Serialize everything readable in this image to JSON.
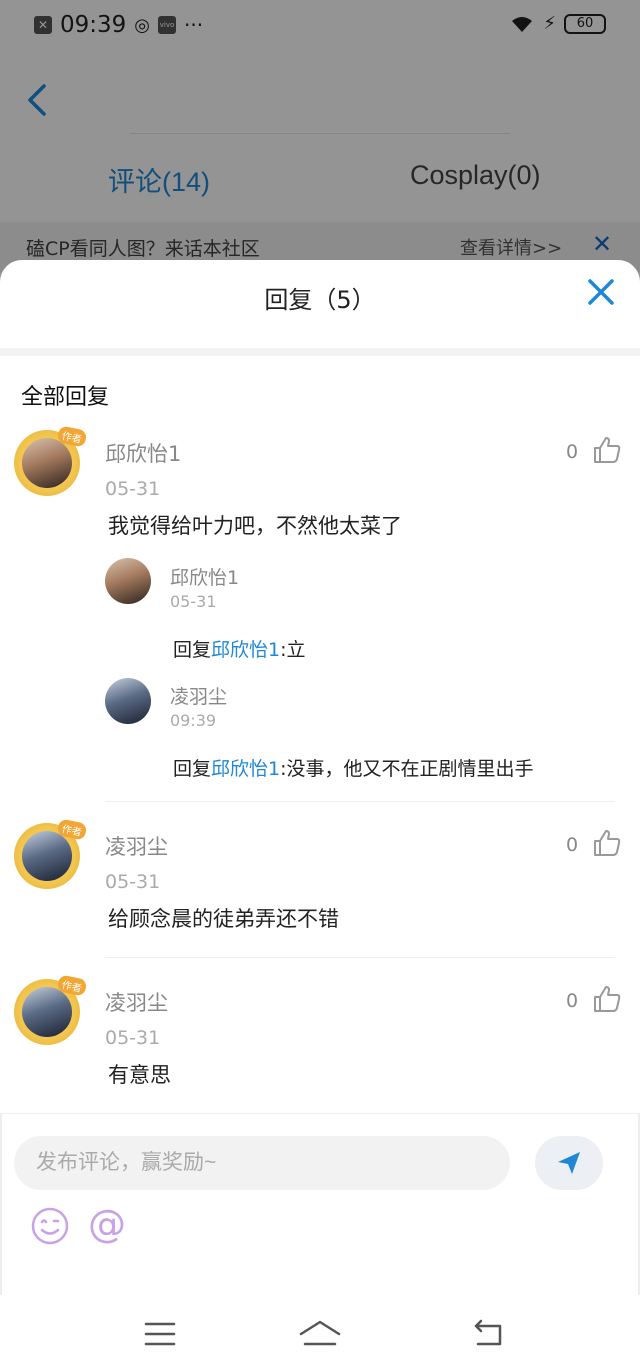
{
  "status_bar": {
    "time": "09:39",
    "battery": "60",
    "notif_icon": "vivo-icon"
  },
  "background_page": {
    "tabs": [
      {
        "label": "评论(14)",
        "active": true
      },
      {
        "label": "Cosplay(0)",
        "active": false
      }
    ],
    "banner": {
      "text": "磕CP看同人图？来话本社区",
      "link": "查看详情>>",
      "close": "✕"
    }
  },
  "sheet": {
    "title": "回复（5）",
    "section_label": "全部回复",
    "comments": [
      {
        "username": "邱欣怡1",
        "date": "05-31",
        "content": "我觉得给叶力吧，不然他太菜了",
        "likes": "0",
        "author_tag": "作者",
        "replies": [
          {
            "username": "邱欣怡1",
            "date": "05-31",
            "prefix": "回复",
            "mention": "邱欣怡1",
            "text": ":立"
          },
          {
            "username": "凌羽尘",
            "date": "09:39",
            "prefix": "回复",
            "mention": "邱欣怡1",
            "text": ":没事，他又不在正剧情里出手"
          }
        ]
      },
      {
        "username": "凌羽尘",
        "date": "05-31",
        "content": "给顾念晨的徒弟弄还不错",
        "likes": "0",
        "author_tag": "作者"
      },
      {
        "username": "凌羽尘",
        "date": "05-31",
        "content": "有意思",
        "likes": "0",
        "author_tag": "作者"
      }
    ]
  },
  "input": {
    "placeholder": "发布评论，赢奖励~",
    "at_symbol": "@"
  },
  "colors": {
    "accent": "#1e88d6",
    "mention": "#1e88d6",
    "avatar_frame": "#f1c54e"
  }
}
